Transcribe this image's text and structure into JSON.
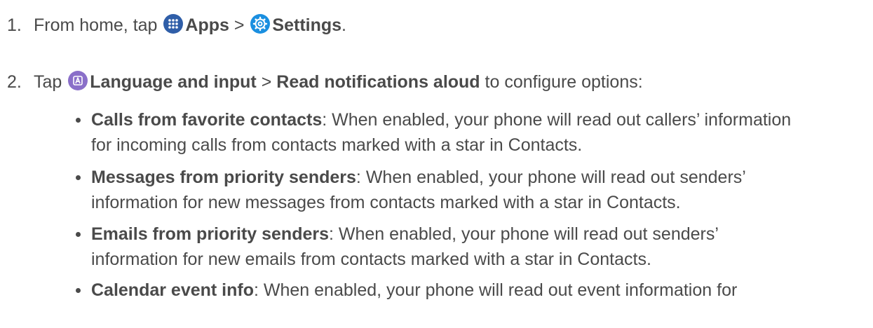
{
  "steps": [
    {
      "number": "1.",
      "prefix": "From home, tap",
      "apps_label": "Apps",
      "separator": ">",
      "settings_label": "Settings",
      "suffix": "."
    },
    {
      "number": "2.",
      "prefix": "Tap",
      "language_label": "Language and input",
      "separator": ">",
      "read_label": "Read notifications aloud",
      "suffix": "to configure options:"
    }
  ],
  "bullets": [
    {
      "term": "Calls from favorite contacts",
      "desc_line1": ": When enabled, your phone will read out callers’ information",
      "desc_line2": "for incoming calls from contacts marked with a star in Contacts."
    },
    {
      "term": "Messages from priority senders",
      "desc_line1": ": When enabled, your phone will read out senders’",
      "desc_line2": "information for new messages from contacts marked with a star in Contacts."
    },
    {
      "term": "Emails from priority senders",
      "desc_line1": ": When enabled, your phone will read out senders’",
      "desc_line2": "information for new emails from contacts marked with a star in Contacts."
    },
    {
      "term": "Calendar event info",
      "desc_line1": ": When enabled, your phone will read out event information for",
      "desc_line2": ""
    }
  ],
  "colors": {
    "text": "#4a4a4a",
    "apps_icon": "#2f5ea8",
    "settings_icon": "#1a8fe0",
    "language_icon": "#8a6fc9"
  },
  "icons": {
    "apps": "apps-grid-icon",
    "settings": "settings-gear-icon",
    "language": "language-a-icon"
  }
}
